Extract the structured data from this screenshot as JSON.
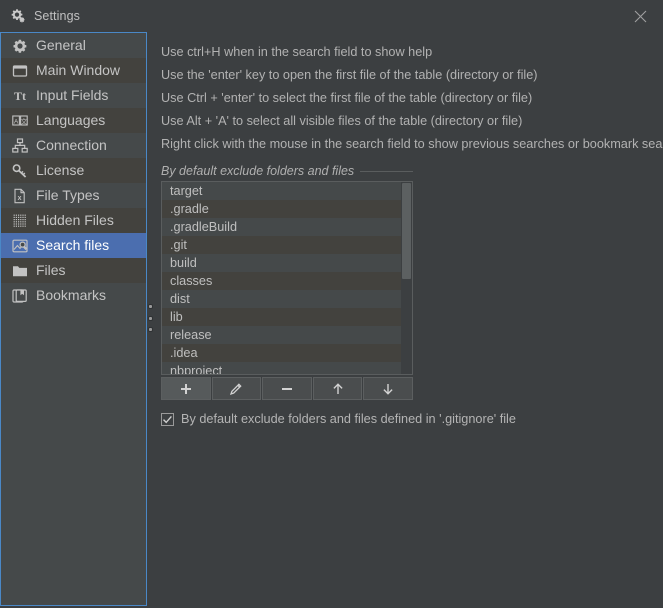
{
  "window": {
    "title": "Settings",
    "title_icon": "gears-icon",
    "close_icon": "close-icon",
    "accent_selection": "#4b6eaf",
    "focus_border": "#4a88c7",
    "background": "#3c3f41"
  },
  "sidebar": {
    "items": [
      {
        "label": "General",
        "icon": "gear-icon",
        "selected": false
      },
      {
        "label": "Main Window",
        "icon": "window-icon",
        "selected": false
      },
      {
        "label": "Input Fields",
        "icon": "text-format-icon",
        "selected": false
      },
      {
        "label": "Languages",
        "icon": "languages-icon",
        "selected": false
      },
      {
        "label": "Connection",
        "icon": "network-icon",
        "selected": false
      },
      {
        "label": "License",
        "icon": "key-icon",
        "selected": false
      },
      {
        "label": "File Types",
        "icon": "file-x-icon",
        "selected": false
      },
      {
        "label": "Hidden Files",
        "icon": "dotted-grid-icon",
        "selected": false
      },
      {
        "label": "Search files",
        "icon": "image-search-icon",
        "selected": true
      },
      {
        "label": "Files",
        "icon": "folder-icon",
        "selected": false
      },
      {
        "label": "Bookmarks",
        "icon": "bookmarks-icon",
        "selected": false
      }
    ],
    "splitter_icon": "splitter-dots-icon"
  },
  "main": {
    "help_lines": [
      "Use ctrl+H when in the search field to show help",
      "Use the 'enter' key to open the first file of the table (directory or file)",
      "Use Ctrl + 'enter' to select the first file of the table (directory or file)",
      "Use Alt + 'A' to select all visible files of the table (directory or file)",
      "Right click with the mouse in the search field to show previous searches or bookmark searches."
    ],
    "group_title": "By default exclude folders and files",
    "exclude_list": [
      "target",
      ".gradle",
      ".gradleBuild",
      ".git",
      "build",
      "classes",
      "dist",
      "lib",
      "release",
      ".idea",
      "nbproject"
    ],
    "toolbar_buttons": [
      {
        "icon": "plus-icon",
        "name": "add-entry-button"
      },
      {
        "icon": "pencil-icon",
        "name": "edit-entry-button"
      },
      {
        "icon": "minus-icon",
        "name": "remove-entry-button"
      },
      {
        "icon": "arrow-up-icon",
        "name": "move-up-button"
      },
      {
        "icon": "arrow-down-icon",
        "name": "move-down-button"
      }
    ],
    "gitignore_checkbox": {
      "label": "By default exclude folders and files defined in '.gitignore' file",
      "checked": true
    }
  }
}
